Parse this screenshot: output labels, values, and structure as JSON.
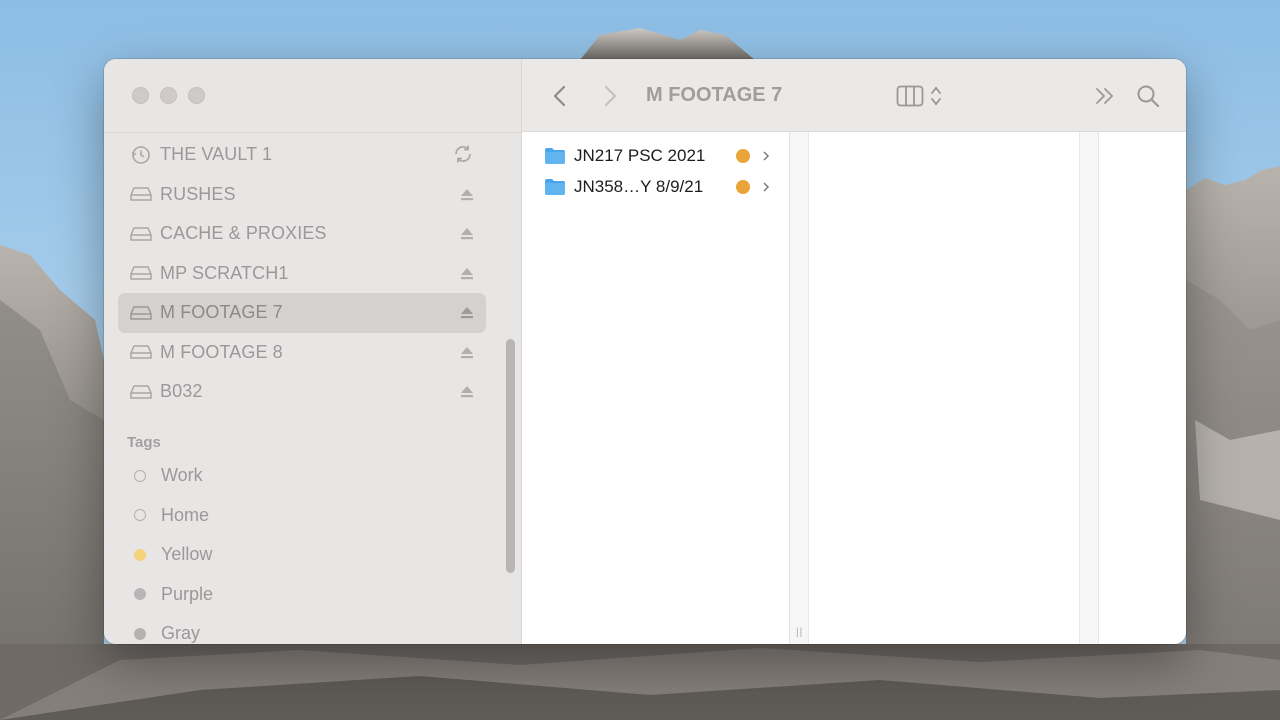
{
  "window": {
    "title": "M FOOTAGE 7"
  },
  "sidebar": {
    "locations": [
      {
        "label": "THE VAULT 1",
        "icon": "time-machine-icon",
        "action": "sync-icon"
      },
      {
        "label": "RUSHES",
        "icon": "drive-icon",
        "action": "eject-icon"
      },
      {
        "label": "CACHE & PROXIES",
        "icon": "drive-icon",
        "action": "eject-icon"
      },
      {
        "label": "MP SCRATCH1",
        "icon": "drive-icon",
        "action": "eject-icon"
      },
      {
        "label": "M FOOTAGE 7",
        "icon": "drive-icon",
        "action": "eject-icon",
        "selected": true
      },
      {
        "label": "M FOOTAGE 8",
        "icon": "drive-icon",
        "action": "eject-icon"
      },
      {
        "label": "B032",
        "icon": "drive-icon",
        "action": "eject-icon"
      }
    ],
    "tags_title": "Tags",
    "tags": [
      {
        "label": "Work",
        "color": "",
        "style": "hollow"
      },
      {
        "label": "Home",
        "color": "",
        "style": "hollow"
      },
      {
        "label": "Yellow",
        "color": "#f3d27c",
        "style": "filled"
      },
      {
        "label": "Purple",
        "color": "#b9b5b7",
        "style": "filled"
      },
      {
        "label": "Gray",
        "color": "#b5b2b2",
        "style": "filled"
      }
    ]
  },
  "toolbar": {
    "back_icon": "chevron-left-icon",
    "forward_icon": "chevron-right-icon",
    "view_icon": "column-view-icon",
    "more_icon": "double-chevron-icon",
    "search_icon": "search-icon"
  },
  "files": [
    {
      "name": "JN217 PSC 2021",
      "tag_color": "#e9a43a",
      "kind": "folder"
    },
    {
      "name": "JN358…Y 8/9/21",
      "tag_color": "#e9a43a",
      "kind": "folder"
    }
  ],
  "colors": {
    "accent_folder": "#4aa5ea",
    "tag_orange": "#e9a43a",
    "sidebar_selected": "#d5d1cf"
  }
}
